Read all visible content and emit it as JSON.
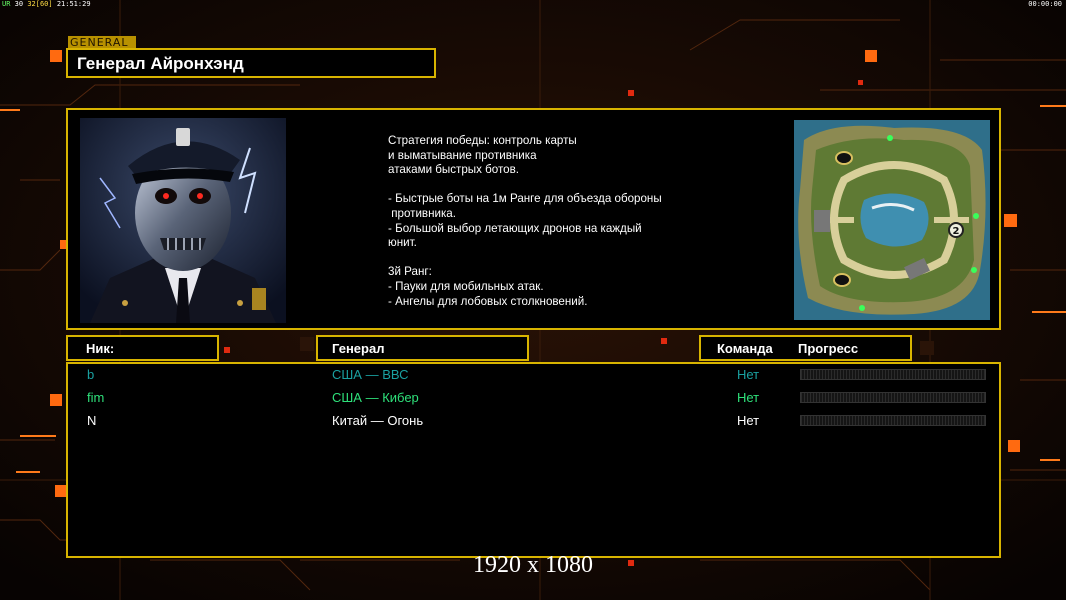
{
  "status": {
    "label": "UR",
    "fps": "30",
    "fps_cap": "32[60]",
    "clock": "21:51:29",
    "timer": "00:00:00"
  },
  "colors": {
    "frame": "#d8b400",
    "accent": "#ff7a1a",
    "row_teal": "#1aa0a0",
    "row_green": "#2ee07a",
    "row_white": "#ffffff"
  },
  "general": {
    "tag": "GENERAL",
    "name": "Генерал Айронхэнд",
    "description": "Стратегия победы: контроль карты\nи выматывание противника\nатаками быстрых ботов.\n\n- Быстрые боты на 1м Ранге для объезда обороны\n противника.\n- Большой выбор летающих дронов на каждый\nюнит.\n\n3й Ранг:\n- Пауки для мобильных атак.\n- Ангелы для лобовых столкновений.",
    "portrait_icon": "cyborg-general-portrait",
    "map_icon": "island-minimap",
    "map_marker": "2"
  },
  "table": {
    "headers": {
      "nick": "Ник:",
      "general": "Генерал",
      "team": "Команда",
      "progress": "Прогресс"
    },
    "rows": [
      {
        "nick": "b",
        "general": "США — ВВС",
        "team": "Нет",
        "color": "#1aa0a0"
      },
      {
        "nick": "fim",
        "general": "США — Кибер",
        "team": "Нет",
        "color": "#2ee07a"
      },
      {
        "nick": "N",
        "general": "Китай — Огонь",
        "team": "Нет",
        "color": "#ffffff"
      }
    ]
  },
  "resolution": "1920 x 1080"
}
